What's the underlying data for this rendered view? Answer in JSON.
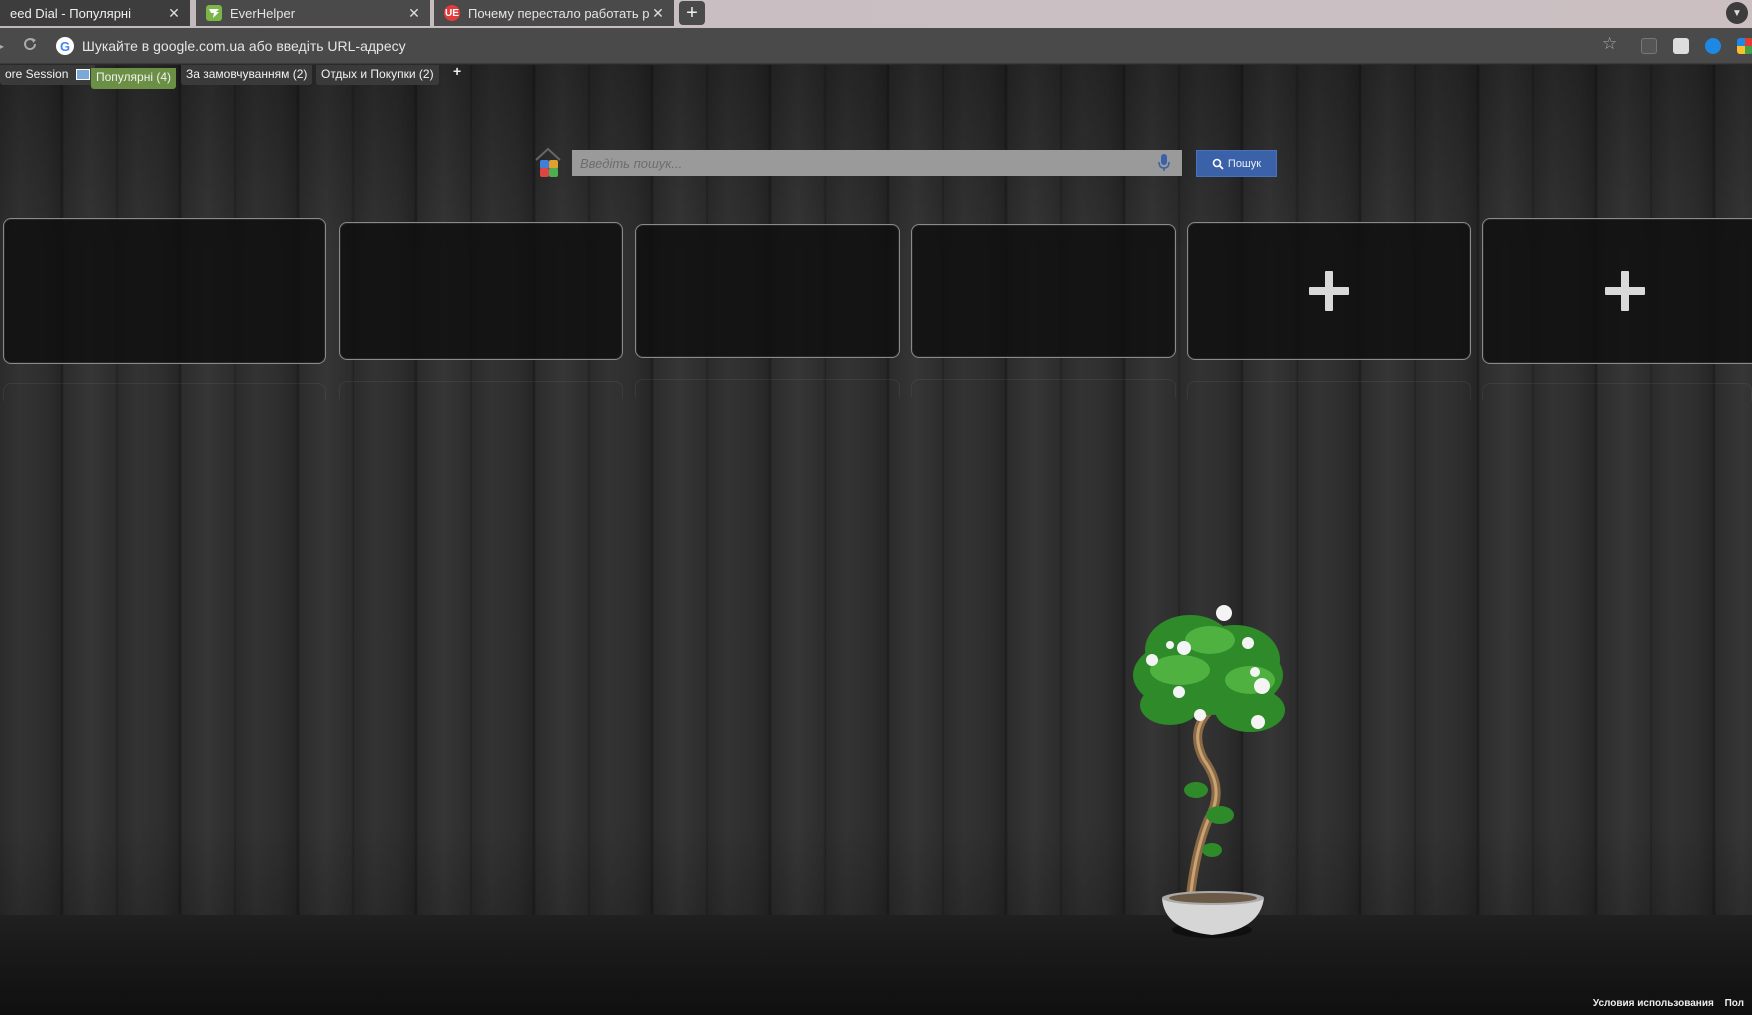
{
  "browser": {
    "tabs": [
      {
        "title": "eed Dial - Популярні",
        "icon": "speed-dial-icon",
        "active": true
      },
      {
        "title": "EverHelper",
        "icon": "everhelper-icon",
        "active": false
      },
      {
        "title": "Почему перестало работать ра",
        "icon": "ue-icon",
        "icon_text": "UE",
        "active": false
      }
    ],
    "new_tab_symbol": "+",
    "close_symbol": "✕",
    "omnibox_placeholder": "Шукайте в google.com.ua або введіть URL-адресу",
    "google_letter": "G"
  },
  "groups": {
    "items": [
      {
        "label": "ore Session",
        "active": false
      },
      {
        "label": "Популярні (4)",
        "active": true
      },
      {
        "label": "За замовчуванням (2)",
        "active": false
      },
      {
        "label": "Отдых и Покупки (2)",
        "active": false
      }
    ],
    "add_symbol": "+"
  },
  "search": {
    "placeholder": "Введіть пошук...",
    "button_label": "Пошук"
  },
  "dials": [
    {
      "type": "empty"
    },
    {
      "type": "empty"
    },
    {
      "type": "empty"
    },
    {
      "type": "empty"
    },
    {
      "type": "add"
    },
    {
      "type": "add"
    }
  ],
  "footer": {
    "terms": "Условия использования",
    "privacy": "Пол"
  },
  "colors": {
    "active_group": "#6a8f45",
    "search_button": "#3b62a8"
  }
}
